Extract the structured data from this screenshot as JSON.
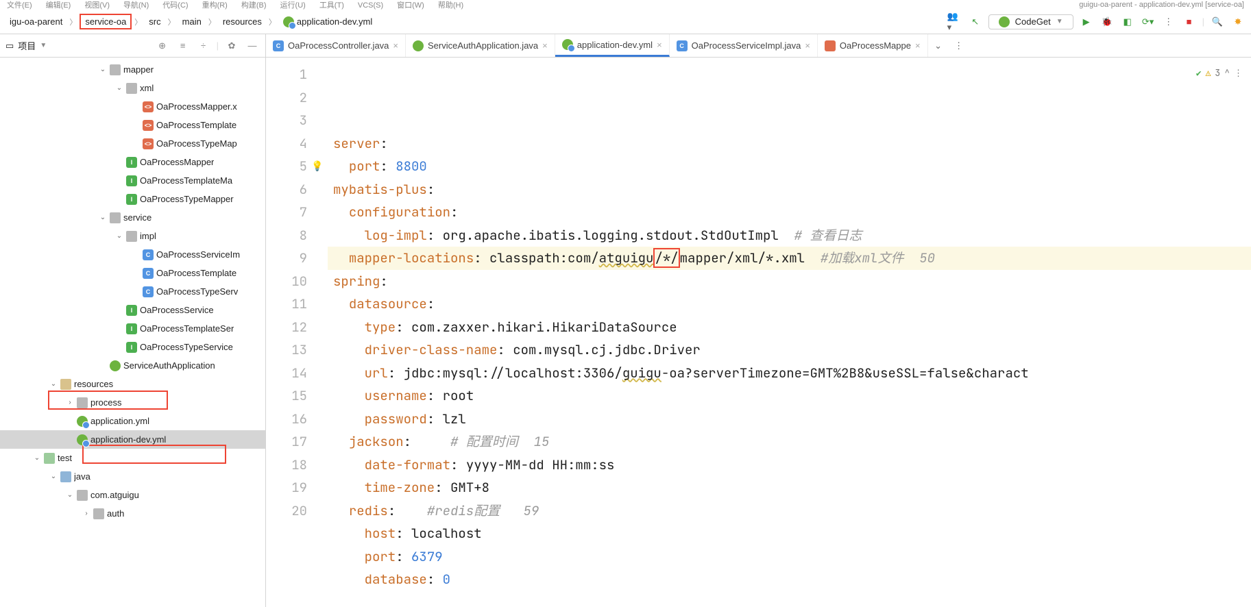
{
  "topMenuLeft": [
    "文件(E)",
    "编辑(E)",
    "视图(V)",
    "导航(N)",
    "代码(C)",
    "重构(R)",
    "构建(B)",
    "运行(U)",
    "工具(T)",
    "VCS(S)",
    "窗口(W)",
    "帮助(H)"
  ],
  "topMenuRight": "guigu-oa-parent - application-dev.yml [service-oa]",
  "breadcrumb": [
    "igu-oa-parent",
    "service-oa",
    "src",
    "main",
    "resources",
    "application-dev.yml"
  ],
  "breadcrumbSelectedIndex": 1,
  "runConfig": "CodeGet",
  "projectPanelTitle": "项目",
  "inspection": {
    "count": "3",
    "caret": "^",
    "more": "⋮"
  },
  "tabs": [
    {
      "label": "OaProcessController.java",
      "icon": "cls"
    },
    {
      "label": "ServiceAuthApplication.java",
      "icon": "spring"
    },
    {
      "label": "application-dev.yml",
      "icon": "yaml",
      "active": true
    },
    {
      "label": "OaProcessServiceImpl.java",
      "icon": "cls"
    },
    {
      "label": "OaProcessMappe",
      "icon": "xml"
    }
  ],
  "tree": [
    {
      "indent": 6,
      "chev": "v",
      "icon": "folder",
      "label": "mapper"
    },
    {
      "indent": 7,
      "chev": "v",
      "icon": "folder",
      "label": "xml"
    },
    {
      "indent": 8,
      "chev": "",
      "icon": "xml",
      "label": "OaProcessMapper.x"
    },
    {
      "indent": 8,
      "chev": "",
      "icon": "xml",
      "label": "OaProcessTemplate"
    },
    {
      "indent": 8,
      "chev": "",
      "icon": "xml",
      "label": "OaProcessTypeMap"
    },
    {
      "indent": 7,
      "chev": "",
      "icon": "iface",
      "label": "OaProcessMapper"
    },
    {
      "indent": 7,
      "chev": "",
      "icon": "iface",
      "label": "OaProcessTemplateMa"
    },
    {
      "indent": 7,
      "chev": "",
      "icon": "iface",
      "label": "OaProcessTypeMapper"
    },
    {
      "indent": 6,
      "chev": "v",
      "icon": "folder",
      "label": "service"
    },
    {
      "indent": 7,
      "chev": "v",
      "icon": "folder",
      "label": "impl"
    },
    {
      "indent": 8,
      "chev": "",
      "icon": "cls",
      "label": "OaProcessServiceIm"
    },
    {
      "indent": 8,
      "chev": "",
      "icon": "cls",
      "label": "OaProcessTemplate"
    },
    {
      "indent": 8,
      "chev": "",
      "icon": "cls",
      "label": "OaProcessTypeServ"
    },
    {
      "indent": 7,
      "chev": "",
      "icon": "iface",
      "label": "OaProcessService"
    },
    {
      "indent": 7,
      "chev": "",
      "icon": "iface",
      "label": "OaProcessTemplateSer"
    },
    {
      "indent": 7,
      "chev": "",
      "icon": "iface",
      "label": "OaProcessTypeService"
    },
    {
      "indent": 6,
      "chev": "",
      "icon": "spring",
      "label": "ServiceAuthApplication"
    },
    {
      "indent": 3,
      "chev": "v",
      "icon": "folder-res",
      "label": "resources"
    },
    {
      "indent": 4,
      "chev": ">",
      "icon": "folder",
      "label": "process"
    },
    {
      "indent": 4,
      "chev": "",
      "icon": "yaml",
      "label": "application.yml"
    },
    {
      "indent": 4,
      "chev": "",
      "icon": "yaml",
      "label": "application-dev.yml",
      "selected": true
    },
    {
      "indent": 2,
      "chev": "v",
      "icon": "folder-test",
      "label": "test"
    },
    {
      "indent": 3,
      "chev": "v",
      "icon": "folder-src",
      "label": "java"
    },
    {
      "indent": 4,
      "chev": "v",
      "icon": "folder",
      "label": "com.atguigu"
    },
    {
      "indent": 5,
      "chev": ">",
      "icon": "folder",
      "label": "auth"
    }
  ],
  "code": {
    "lineStart": 1,
    "bulbLine": 5,
    "highlightLine": 6,
    "lines": [
      {
        "t": [
          [
            "kw",
            "server"
          ],
          [
            "",
            ":"
          ]
        ]
      },
      {
        "t": [
          [
            "",
            "  "
          ],
          [
            "kw",
            "port"
          ],
          [
            "",
            ": "
          ],
          [
            "val",
            "8800"
          ]
        ]
      },
      {
        "t": [
          [
            "kw",
            "mybatis-plus"
          ],
          [
            "",
            ":"
          ]
        ]
      },
      {
        "t": [
          [
            "",
            "  "
          ],
          [
            "kw",
            "configuration"
          ],
          [
            "",
            ":"
          ]
        ]
      },
      {
        "t": [
          [
            "",
            "    "
          ],
          [
            "kw",
            "log-impl"
          ],
          [
            "",
            ": org.apache.ibatis.logging.stdout.StdOutImpl  "
          ],
          [
            "cm",
            "# 查看日志"
          ]
        ]
      },
      {
        "t": [
          [
            "",
            "  "
          ],
          [
            "kw",
            "mapper-locations"
          ],
          [
            "",
            ": classpath:com/"
          ],
          [
            "wavy",
            "atguigu"
          ],
          [
            "redbox",
            "/*/"
          ],
          [
            "",
            "mapper/xml/*.xml  "
          ],
          [
            "cm",
            "#加载xml文件  50"
          ]
        ]
      },
      {
        "t": [
          [
            "kw",
            "spring"
          ],
          [
            "",
            ":"
          ]
        ]
      },
      {
        "t": [
          [
            "",
            "  "
          ],
          [
            "kw",
            "datasource"
          ],
          [
            "",
            ":"
          ]
        ]
      },
      {
        "t": [
          [
            "",
            "    "
          ],
          [
            "kw",
            "type"
          ],
          [
            "",
            ": com.zaxxer.hikari.HikariDataSource"
          ]
        ]
      },
      {
        "t": [
          [
            "",
            "    "
          ],
          [
            "kw",
            "driver-class-name"
          ],
          [
            "",
            ": com.mysql.cj.jdbc.Driver"
          ]
        ]
      },
      {
        "t": [
          [
            "",
            "    "
          ],
          [
            "kw",
            "url"
          ],
          [
            "",
            ": jdbc:mysql://localhost:3306/"
          ],
          [
            "wavy",
            "guigu"
          ],
          [
            "",
            "-oa?serverTimezone=GMT%2B8&useSSL=false&charact"
          ]
        ]
      },
      {
        "t": [
          [
            "",
            "    "
          ],
          [
            "kw",
            "username"
          ],
          [
            "",
            ": root"
          ]
        ]
      },
      {
        "t": [
          [
            "",
            "    "
          ],
          [
            "kw",
            "password"
          ],
          [
            "",
            ": lzl"
          ]
        ]
      },
      {
        "t": [
          [
            "",
            "  "
          ],
          [
            "kw",
            "jackson"
          ],
          [
            "",
            ":     "
          ],
          [
            "cm",
            "# 配置时间  15"
          ]
        ]
      },
      {
        "t": [
          [
            "",
            "    "
          ],
          [
            "kw",
            "date-format"
          ],
          [
            "",
            ": yyyy-MM-dd HH:mm:ss"
          ]
        ]
      },
      {
        "t": [
          [
            "",
            "    "
          ],
          [
            "kw",
            "time-zone"
          ],
          [
            "",
            ": GMT+8"
          ]
        ]
      },
      {
        "t": [
          [
            "",
            "  "
          ],
          [
            "kw",
            "redis"
          ],
          [
            "",
            ":    "
          ],
          [
            "cm",
            "#redis配置   59"
          ]
        ]
      },
      {
        "t": [
          [
            "",
            "    "
          ],
          [
            "kw",
            "host"
          ],
          [
            "",
            ": localhost"
          ]
        ]
      },
      {
        "t": [
          [
            "",
            "    "
          ],
          [
            "kw",
            "port"
          ],
          [
            "",
            ": "
          ],
          [
            "val",
            "6379"
          ]
        ]
      },
      {
        "t": [
          [
            "",
            "    "
          ],
          [
            "kw",
            "database"
          ],
          [
            "",
            ": "
          ],
          [
            "val",
            "0"
          ]
        ]
      }
    ]
  }
}
